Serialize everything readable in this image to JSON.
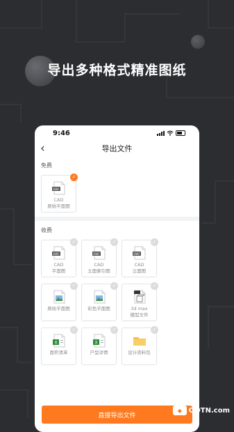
{
  "headline": "导出多种格式精准图纸",
  "status": {
    "time": "9:46"
  },
  "nav": {
    "title": "导出文件"
  },
  "free": {
    "label": "免费",
    "items": [
      {
        "label": "CAD\n原始平面图",
        "icon": "dwg-file-icon",
        "selected": true
      }
    ]
  },
  "paid": {
    "label": "收费",
    "items": [
      {
        "label": "CAD\n平面图",
        "icon": "dwg-file-icon",
        "selected": false
      },
      {
        "label": "CAD\n立面索引图",
        "icon": "dwg-file-icon",
        "selected": false
      },
      {
        "label": "CAD\n立面图",
        "icon": "dwg-file-icon",
        "selected": false
      },
      {
        "label": "原始平面图",
        "icon": "image-file-icon",
        "selected": false
      },
      {
        "label": "彩色平面图",
        "icon": "image-file-icon",
        "selected": false
      },
      {
        "label": "3d max\n模型文件",
        "icon": "max-file-icon",
        "selected": false
      },
      {
        "label": "面积清单",
        "icon": "excel-file-icon",
        "selected": false
      },
      {
        "label": "户型详情",
        "icon": "excel-file-icon",
        "selected": false
      },
      {
        "label": "设计资料包",
        "icon": "folder-icon",
        "selected": false
      }
    ]
  },
  "action": {
    "label": "直接导出文件"
  },
  "watermark": {
    "text": "QQTN.com"
  },
  "colors": {
    "accent": "#ff7a1f",
    "background": "#2c2d31"
  }
}
